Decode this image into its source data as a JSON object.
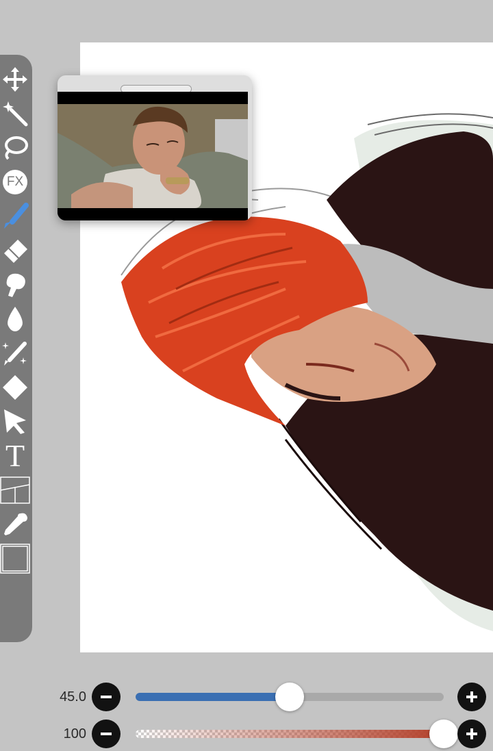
{
  "canvas": {
    "background": "#ffffff",
    "hair_color": "#d9411f",
    "sweater_color": "#2a1414"
  },
  "toolbar": {
    "background": "#7a7a7a",
    "icon_color": "#ffffff",
    "active_color": "#4a8fe0",
    "tools": [
      {
        "name": "move-tool",
        "icon": "move-icon",
        "active": false
      },
      {
        "name": "magic-wand-tool",
        "icon": "magic-wand-icon",
        "active": false
      },
      {
        "name": "lasso-tool",
        "icon": "lasso-icon",
        "active": false
      },
      {
        "name": "fx-tool",
        "icon": "fx-icon",
        "label": "FX",
        "active": false
      },
      {
        "name": "brush-tool",
        "icon": "brush-icon",
        "active": true
      },
      {
        "name": "eraser-tool",
        "icon": "eraser-icon",
        "active": false
      },
      {
        "name": "smudge-tool",
        "icon": "smudge-icon",
        "active": false
      },
      {
        "name": "blur-tool",
        "icon": "water-drop-icon",
        "active": false
      },
      {
        "name": "special-pen-tool",
        "icon": "sparkle-pen-icon",
        "active": false
      },
      {
        "name": "fill-tool",
        "icon": "diamond-icon",
        "active": false
      },
      {
        "name": "select-tool",
        "icon": "arrow-cursor-icon",
        "active": false
      },
      {
        "name": "text-tool",
        "icon": "text-icon",
        "label": "T",
        "active": false
      },
      {
        "name": "frame-tool",
        "icon": "panel-divider-icon",
        "active": false
      },
      {
        "name": "eyedropper-tool",
        "icon": "eyedropper-icon",
        "active": false
      },
      {
        "name": "canvas-tool",
        "icon": "canvas-icon",
        "active": false
      }
    ]
  },
  "reference_window": {
    "icon": "reference-photo"
  },
  "sliders": {
    "size": {
      "value_label": "45.0",
      "fraction": 0.5,
      "fill_color": "#3a6fb3"
    },
    "opacity": {
      "value_label": "100",
      "fraction": 1.0,
      "fill_color": "#b3402a"
    },
    "minus_icon": "minus-icon",
    "plus_icon": "plus-icon"
  }
}
